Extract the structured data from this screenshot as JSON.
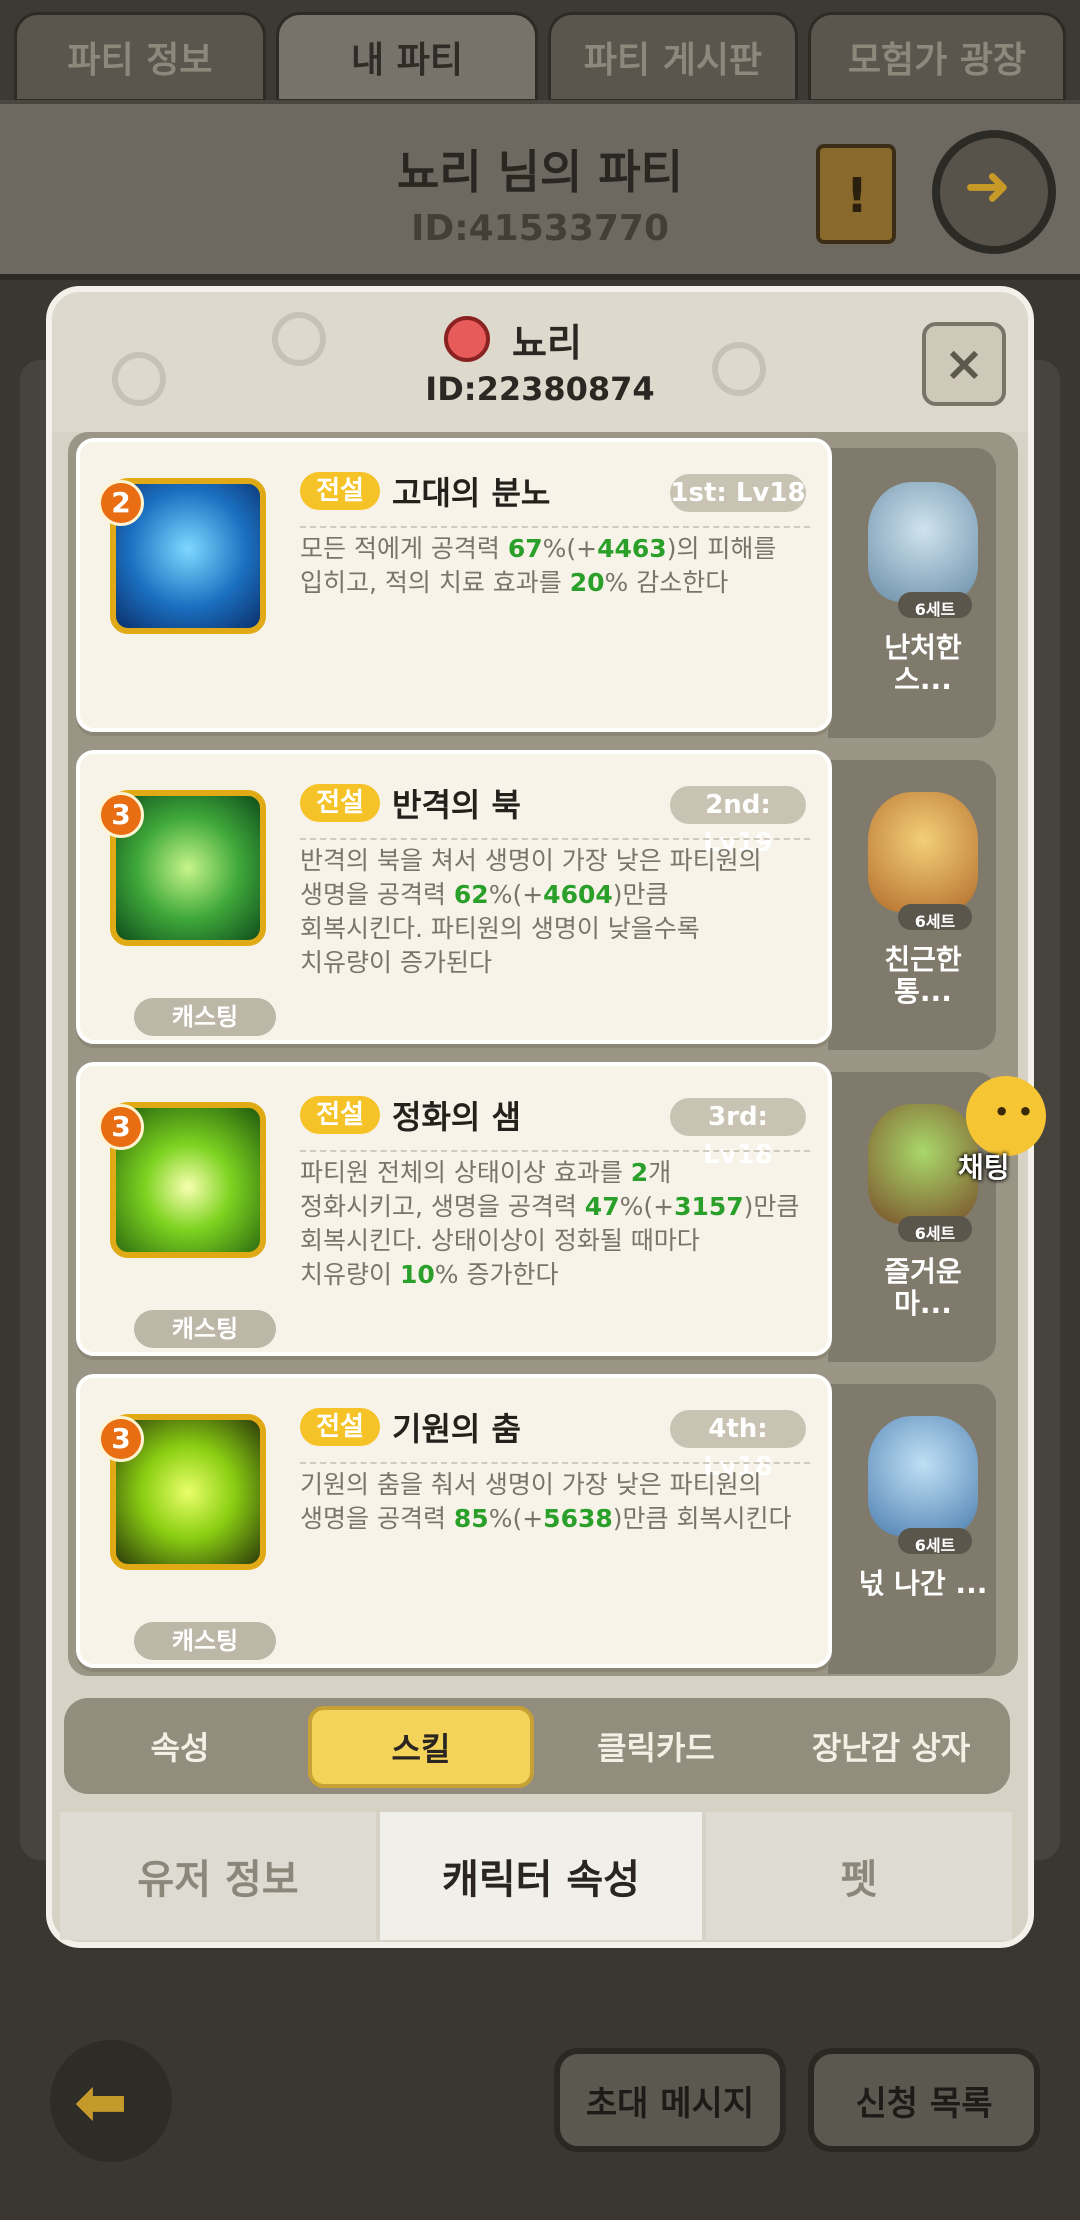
{
  "top_tabs": [
    "파티 정보",
    "내 파티",
    "파티 게시판",
    "모험가 광장"
  ],
  "party": {
    "title": "뇨리 님의 파티",
    "id": "ID:41533770"
  },
  "profile": {
    "name": "뇨리",
    "id": "ID:22380874",
    "close_label": "×"
  },
  "skills": [
    {
      "badge_number": "2",
      "tier": "전설",
      "name": "고대의 분노",
      "rank": "1st: Lv18",
      "casting_label": "",
      "desc_lines": [
        "모든 적에게 공격력 67%(+4463)의 피해를",
        "입히고, 적의 치료 효과를 20% 감소한다"
      ],
      "character": {
        "set": "6세트",
        "name_line1": "난처한",
        "name_line2": "스..."
      }
    },
    {
      "badge_number": "3",
      "tier": "전설",
      "name": "반격의 북",
      "rank": "2nd: Lv19",
      "casting_label": "캐스팅",
      "desc_lines": [
        "반격의 북을 쳐서 생명이 가장 낮은 파티원의",
        "생명을 공격력 62%(+4604)만큼",
        "회복시킨다. 파티원의 생명이 낮을수록",
        "치유량이 증가된다"
      ],
      "character": {
        "set": "6세트",
        "name_line1": "친근한",
        "name_line2": "통..."
      }
    },
    {
      "badge_number": "3",
      "tier": "전설",
      "name": "정화의 샘",
      "rank": "3rd: Lv18",
      "casting_label": "캐스팅",
      "desc_lines": [
        "파티원 전체의 상태이상 효과를 2개",
        "정화시키고, 생명을 공격력 47%(+3157)만큼",
        "회복시킨다. 상태이상이 정화될 때마다",
        "치유량이 10% 증가한다"
      ],
      "character": {
        "set": "6세트",
        "name_line1": "즐거운",
        "name_line2": "마..."
      }
    },
    {
      "badge_number": "3",
      "tier": "전설",
      "name": "기원의 춤",
      "rank": "4th: Lv18",
      "casting_label": "캐스팅",
      "desc_lines": [
        "기원의 춤을 춰서 생명이 가장 낮은 파티원의",
        "생명을 공격력 85%(+5638)만큼 회복시킨다"
      ],
      "character": {
        "set": "6세트",
        "name_line1": "넋 나간 ...",
        "name_line2": ""
      }
    }
  ],
  "chat": {
    "label": "채팅"
  },
  "sub_tabs": [
    "속성",
    "스킬",
    "클릭카드",
    "장난감 상자"
  ],
  "bottom_tabs": [
    "유저 정보",
    "캐릭터 속성",
    "펫"
  ],
  "footer": {
    "invite": "초대 메시지",
    "requests": "신청 목록"
  },
  "colors": {
    "tier": "#f5c327",
    "highlight": "#2aa02a",
    "accent_tab": "#f4d35a",
    "badge": "#e96d12"
  },
  "icons": [
    "exit-icon",
    "map-icon",
    "back-arrow-icon",
    "close-icon",
    "key-icon",
    "chat-icon"
  ]
}
